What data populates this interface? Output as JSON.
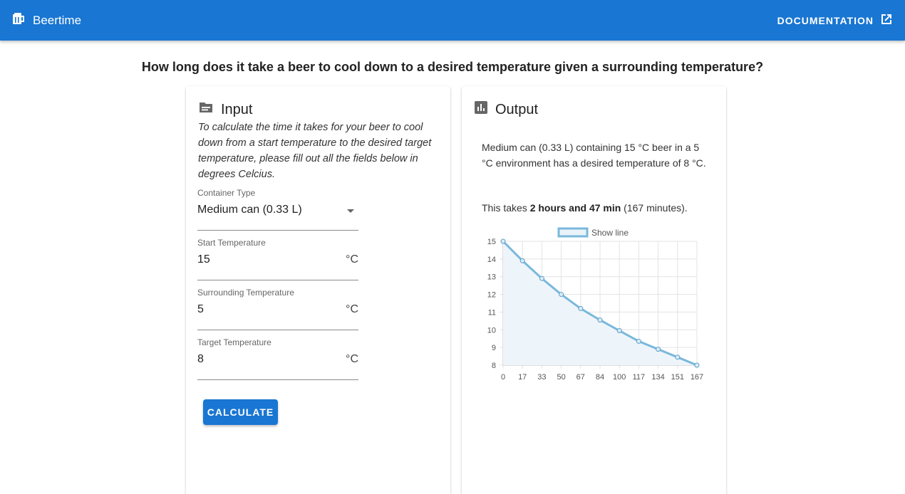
{
  "appbar": {
    "title": "Beertime",
    "doc_label": "DOCUMENTATION",
    "color": "#1976d2",
    "brand_icon": "beer-mug-icon",
    "doc_icon": "open-in-new-icon"
  },
  "headline": "How long does it take a beer to cool down to a desired temperature given a surrounding temperature?",
  "input_card": {
    "title": "Input",
    "icon": "description-icon",
    "description": "To calculate the time it takes for your beer to cool down from a start temperature to the desired target temperature, please fill out all the fields below in degrees Celcius.",
    "fields": [
      {
        "label": "Container Type",
        "value": "Medium can (0.33 L)",
        "suffix": ""
      },
      {
        "label": "Start Temperature",
        "value": "15",
        "suffix": "°C"
      },
      {
        "label": "Surrounding Temperature",
        "value": "5",
        "suffix": "°C"
      },
      {
        "label": "Target Temperature",
        "value": "8",
        "suffix": "°C"
      }
    ],
    "button_label": "CALCULATE"
  },
  "output_card": {
    "title": "Output",
    "icon": "bar-chart-icon",
    "summary": "Medium can (0.33 L) containing 15 °C beer in a 5 °C environment has a desired temperature of 8 °C.",
    "time_prefix": "This takes ",
    "time_bold": "2 hours and 47 min",
    "time_suffix": " (167 minutes)."
  },
  "chart_data": {
    "type": "line",
    "series": [
      {
        "name": "Show line",
        "x": [
          0,
          17,
          33,
          50,
          67,
          84,
          100,
          117,
          134,
          151,
          167
        ],
        "y": [
          15,
          13.9,
          12.9,
          12.0,
          11.2,
          10.55,
          9.95,
          9.35,
          8.9,
          8.45,
          8.0
        ]
      }
    ],
    "x_tick_labels": [
      "0",
      "17",
      "33",
      "50",
      "67",
      "84",
      "100",
      "117",
      "134",
      "151",
      "167"
    ],
    "y_tick_labels": [
      "15",
      "14",
      "13",
      "12",
      "11",
      "10",
      "9",
      "8"
    ],
    "ylim": [
      8,
      15
    ],
    "grid": true,
    "legend_position": "top-center",
    "line_color": "#79b8dc",
    "fill_color": "#eef5fa"
  }
}
